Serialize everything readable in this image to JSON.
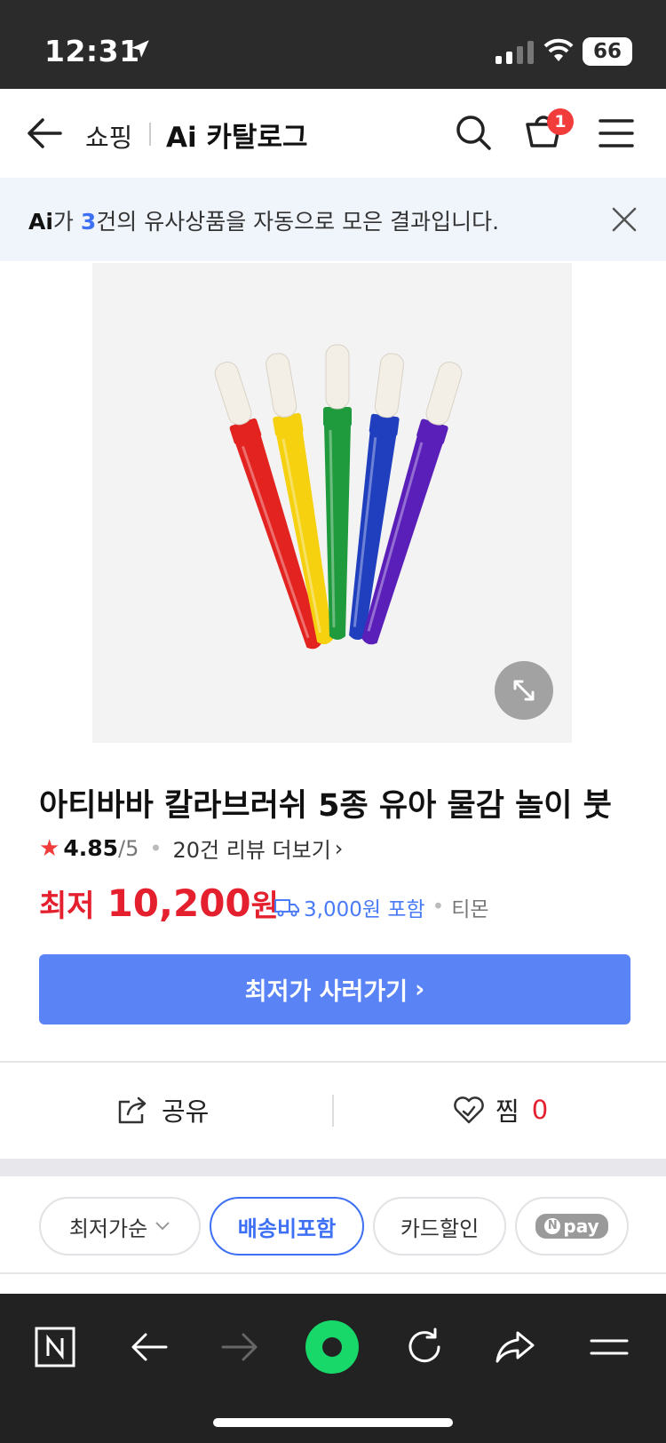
{
  "status_bar": {
    "time": "12:31",
    "battery": "66"
  },
  "header": {
    "shopping": "쇼핑",
    "catalog": "Ai 카탈로그",
    "cart_count": "1"
  },
  "notice": {
    "ai": "Ai",
    "prefix": "가 ",
    "count": "3",
    "suffix": "건의 유사상품을 자동으로 모은 결과입니다."
  },
  "product": {
    "title": "아티바바 칼라브러쉬 5종 유아 물감 놀이 붓",
    "rating": "4.85",
    "rating_max": "/5",
    "review_text": "20건 리뷰 더보기",
    "price_label": "최저",
    "price_value": "10,200",
    "price_unit": "원",
    "shipping": "3,000원 포함",
    "seller": "티몬",
    "buy_button": "최저가 사러가기",
    "brush_colors": [
      "#e3231f",
      "#f5d10f",
      "#1f9a3c",
      "#1f3fbf",
      "#5a1fb8"
    ]
  },
  "actions": {
    "share": "공유",
    "like": "찜",
    "like_count": "0"
  },
  "filters": {
    "sort": "최저가순",
    "shipping_incl": "배송비포함",
    "card_discount": "카드할인",
    "npay": "pay",
    "npay_n": "N"
  },
  "colors": {
    "accent": "#3d70f5",
    "price": "#e5202e",
    "button": "#5a84f6",
    "green": "#17d869"
  }
}
